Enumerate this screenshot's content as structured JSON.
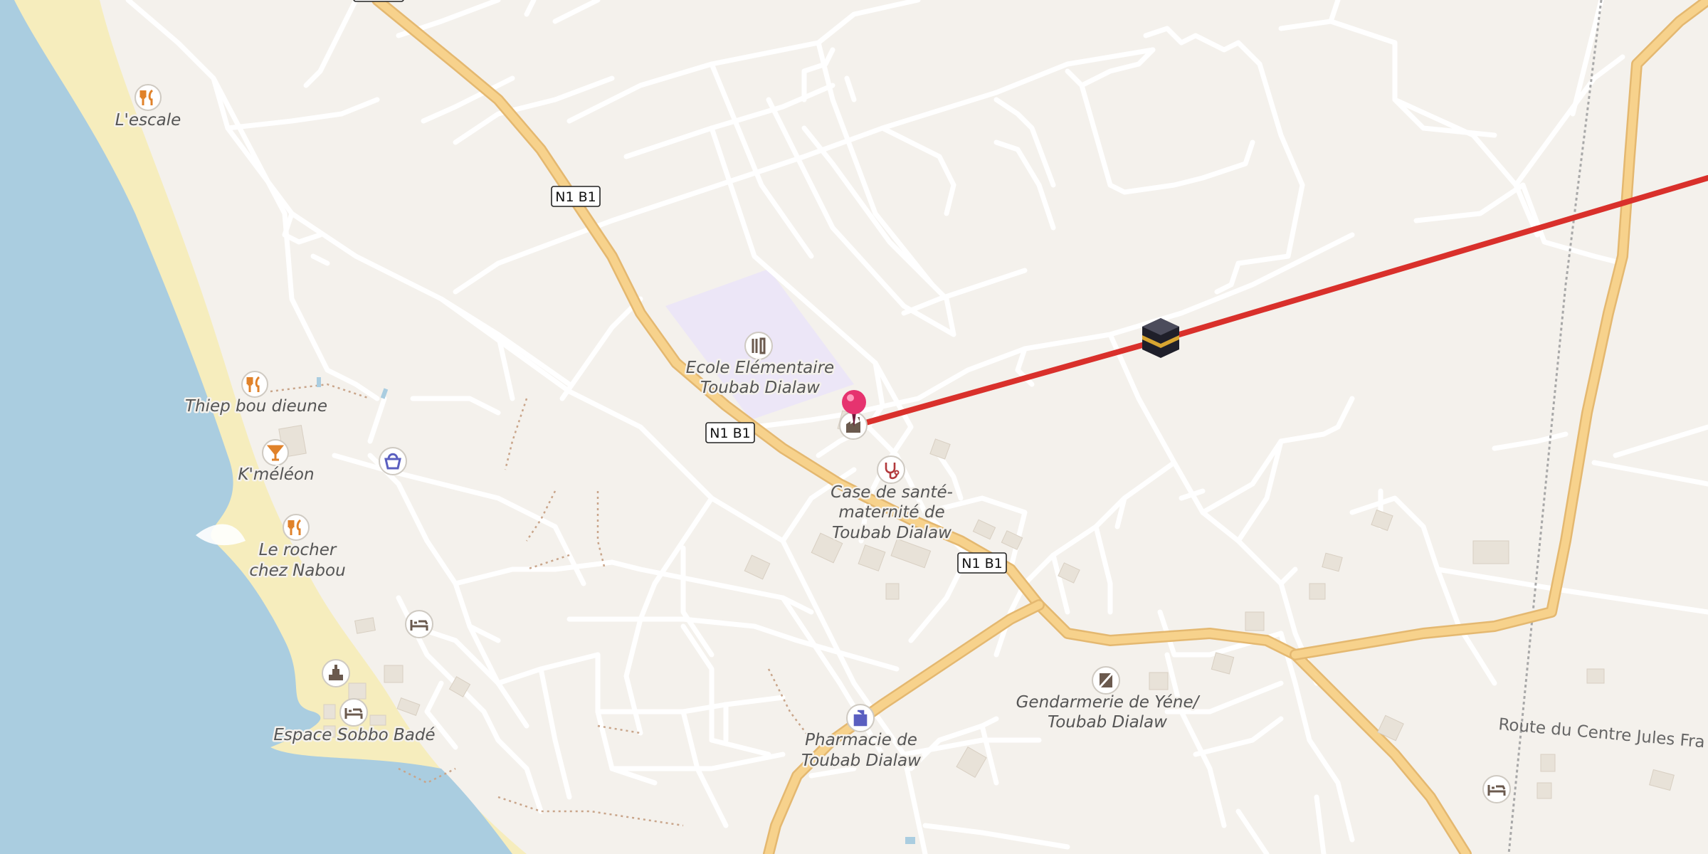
{
  "map": {
    "colors": {
      "land": "#f4f1ec",
      "water": "#aacde0",
      "beach": "#f6edbd",
      "school_area": "#ece6f7",
      "primary_road": "#f7d28c",
      "primary_road_casing": "#e4b870",
      "minor_road": "#ffffff",
      "route_line": "#d9302b",
      "pin": "#e6336f",
      "food_icon": "#e0822a",
      "civic_icon": "#6b5a4e",
      "shop_icon": "#5a5fc0"
    },
    "road_shields": [
      "N1 B1",
      "N1 B1",
      "N1 B1"
    ],
    "road_name": "Route du Centre Jules Fra",
    "places": [
      {
        "name": "L'escale",
        "icon": "restaurant-icon"
      },
      {
        "name": "Thiep bou dieune",
        "icon": "restaurant-icon"
      },
      {
        "name": "K'méléon",
        "icon": "bar-icon"
      },
      {
        "name": "Le rocher",
        "name2": "chez Nabou",
        "icon": "restaurant-icon"
      },
      {
        "name": "Ecole Elémentaire",
        "name2": "Toubab Dialaw",
        "icon": "school-icon"
      },
      {
        "name": "Case de santé-",
        "name2": "maternité de",
        "name3": "Toubab Dialaw",
        "icon": "clinic-icon"
      },
      {
        "name": "Gendarmerie de Yéne/",
        "name2": "Toubab Dialaw",
        "icon": "police-icon"
      },
      {
        "name": "Pharmacie de",
        "name2": "Toubab Dialaw",
        "icon": "pharmacy-icon"
      },
      {
        "name": "Espace Sobbo Badé",
        "icon": "hotel-icon"
      }
    ],
    "markers": [
      "location-pin-icon",
      "kaaba-icon",
      "hotel-icon",
      "hotel-icon",
      "shop-icon",
      "monument-icon",
      "factory-icon"
    ]
  }
}
